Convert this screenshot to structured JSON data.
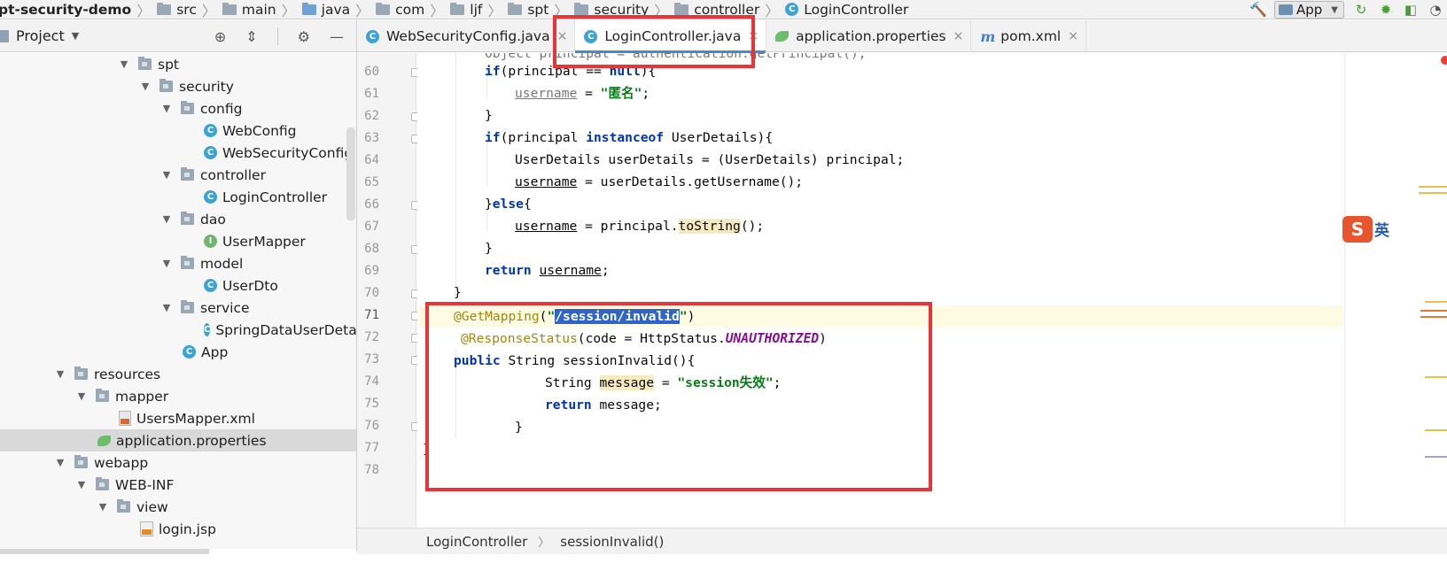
{
  "navbar": {
    "crumbs": [
      "pt-security-demo",
      "src",
      "main",
      "java",
      "com",
      "ljf",
      "spt",
      "security",
      "controller",
      "LoginController"
    ],
    "run_config": "App"
  },
  "project": {
    "title": "Project",
    "tree": [
      {
        "label": "spt",
        "type": "folder",
        "expanded": true
      },
      {
        "label": "security",
        "type": "folder",
        "expanded": true
      },
      {
        "label": "config",
        "type": "folder",
        "expanded": true
      },
      {
        "label": "WebConfig",
        "type": "class"
      },
      {
        "label": "WebSecurityConfig",
        "type": "class"
      },
      {
        "label": "controller",
        "type": "folder",
        "expanded": true
      },
      {
        "label": "LoginController",
        "type": "class"
      },
      {
        "label": "dao",
        "type": "folder",
        "expanded": true
      },
      {
        "label": "UserMapper",
        "type": "interface"
      },
      {
        "label": "model",
        "type": "folder",
        "expanded": true
      },
      {
        "label": "UserDto",
        "type": "class"
      },
      {
        "label": "service",
        "type": "folder",
        "expanded": true
      },
      {
        "label": "SpringDataUserDetail",
        "type": "class"
      },
      {
        "label": "App",
        "type": "class"
      },
      {
        "label": "resources",
        "type": "folder",
        "expanded": true
      },
      {
        "label": "mapper",
        "type": "folder",
        "expanded": true
      },
      {
        "label": "UsersMapper.xml",
        "type": "xml"
      },
      {
        "label": "application.properties",
        "type": "properties",
        "selected": true
      },
      {
        "label": "webapp",
        "type": "folder",
        "expanded": true
      },
      {
        "label": "WEB-INF",
        "type": "folder",
        "expanded": true
      },
      {
        "label": "view",
        "type": "folder",
        "expanded": true
      },
      {
        "label": "login.jsp",
        "type": "jsp"
      }
    ]
  },
  "tabs": [
    {
      "label": "WebSecurityConfig.java",
      "icon": "class-icon",
      "active": false
    },
    {
      "label": "LoginController.java",
      "icon": "class-icon",
      "active": true
    },
    {
      "label": "application.properties",
      "icon": "spring-leaf-icon",
      "active": false
    },
    {
      "label": "pom.xml",
      "icon": "maven-icon",
      "active": false
    }
  ],
  "editor": {
    "line_numbers": [
      "60",
      "61",
      "62",
      "63",
      "64",
      "65",
      "66",
      "67",
      "68",
      "69",
      "70",
      "71",
      "72",
      "73",
      "74",
      "75",
      "76",
      "77",
      "78"
    ],
    "current_line": "71"
  },
  "status": {
    "breadcrumb": [
      "LoginController",
      "sessionInvalid()"
    ]
  },
  "ime": {
    "badge": "S",
    "mode": "英"
  },
  "colors": {
    "highlight_box": "#e8353a",
    "active_tab_underline": "#4a88c7",
    "selection": "#2f65ca"
  }
}
